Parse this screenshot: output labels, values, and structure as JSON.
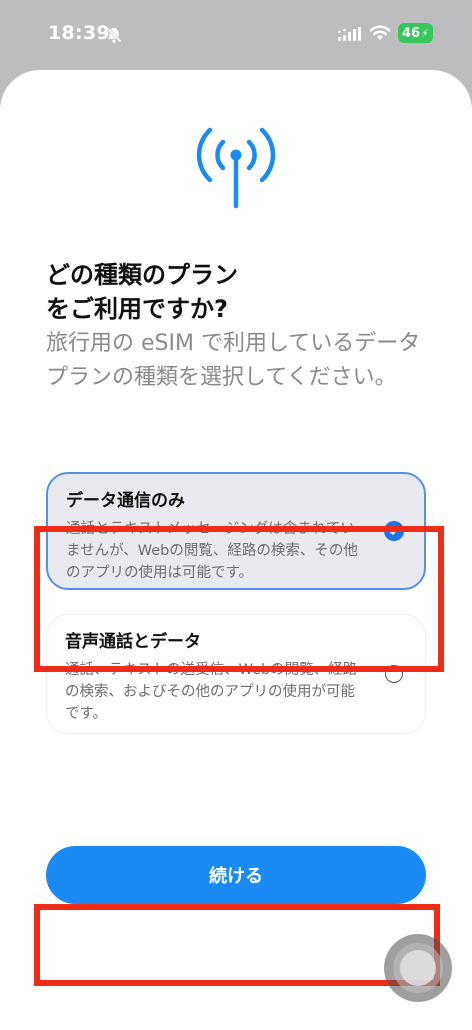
{
  "status_bar": {
    "time": "18:39",
    "battery": "46"
  },
  "page": {
    "title": "どの種類のプラン\nをご利用ですか?",
    "subtitle": "旅行用の eSIM で利用しているデータプランの種類を選択してください。"
  },
  "options": [
    {
      "title": "データ通信のみ",
      "description": "通話とテキストメッセージングは含まれていませんが、Webの閲覧、経路の検索、その他のアプリの使用は可能です。",
      "selected": true
    },
    {
      "title": "音声通話とデータ",
      "description": "通話、テキストの送受信、Webの閲覧、経路の検索、およびその他のアプリの使用が可能です。",
      "selected": false
    }
  ],
  "continue_button": {
    "label": "続ける"
  },
  "colors": {
    "accent": "#1a8bf5",
    "highlight": "#ee2c18",
    "battery": "#34c759"
  },
  "icons": {
    "antenna": "antenna-signal-icon",
    "check": "checkmark-circle-icon",
    "radio": "radio-empty-icon",
    "bell": "bell-slash-icon",
    "signal": "cellular-signal-icon",
    "wifi": "wifi-icon"
  }
}
